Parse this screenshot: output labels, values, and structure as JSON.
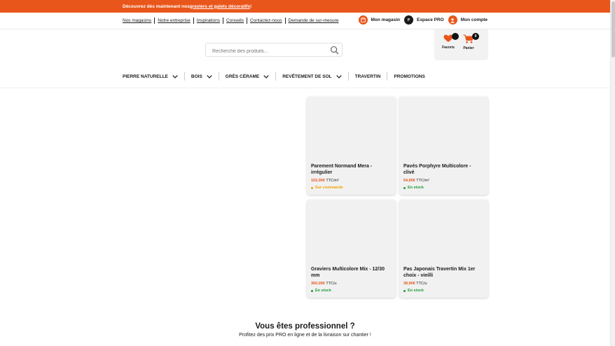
{
  "promo": {
    "text_prefix": "Découvrez dès maintenant nos ",
    "link_text": "graviers et galets décoratifs",
    "text_suffix": " !"
  },
  "toplinks": [
    "Nos magasins",
    "Notre entreprise",
    "Inspirations",
    "Conseils",
    "Contactez-nous",
    "Demande de sur-mesure"
  ],
  "account": {
    "store": "Mon magasin",
    "pro_icon": "P",
    "pro": "Espace PRO",
    "account": "Mon compte"
  },
  "search": {
    "placeholder": "Recherche des produits..."
  },
  "favorites": {
    "label": "Favoris"
  },
  "cart": {
    "label": "Panier",
    "count": "0"
  },
  "nav": [
    {
      "label": "PIERRE NATURELLE",
      "has_dropdown": true
    },
    {
      "label": "BOIS",
      "has_dropdown": true
    },
    {
      "label": "GRÈS CÉRAME",
      "has_dropdown": true
    },
    {
      "label": "REVÊTEMENT DE SOL",
      "has_dropdown": true
    },
    {
      "label": "TRAVERTIN",
      "has_dropdown": false
    },
    {
      "label": "PROMOTIONS",
      "has_dropdown": false
    }
  ],
  "products": [
    {
      "name": "Parement Normand Mera - irrégulier",
      "price": "102,00€",
      "unit": "TTC/m²",
      "stock": "Sur commande",
      "stock_color": "#f2a400"
    },
    {
      "name": "Pavés Porphyre Multicolore - clivé",
      "price": "54,90€",
      "unit": "TTC/m²",
      "stock": "En stock",
      "stock_color": "#1f9d3a"
    },
    {
      "name": "Graviers Multicolore Mix - 12/30 mm",
      "price": "360,00€",
      "unit": "TTC/u",
      "stock": "En stock",
      "stock_color": "#1f9d3a"
    },
    {
      "name": "Pas Japonais Travertin Mix 1er choix - vieilli",
      "price": "39,90€",
      "unit": "TTC/u",
      "stock": "En stock",
      "stock_color": "#1f9d3a"
    }
  ],
  "pro": {
    "title": "Vous êtes professionnel ?",
    "subtitle": "Profitez des prix PRO en ligne et de la livraison sur chantier !"
  },
  "colors": {
    "accent": "#e9561b",
    "in_stock": "#1f9d3a",
    "on_order": "#f2a400"
  }
}
